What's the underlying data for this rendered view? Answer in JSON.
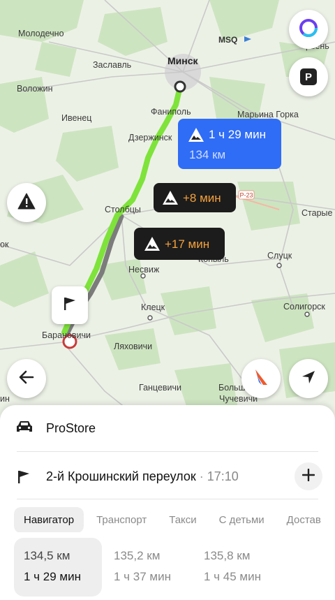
{
  "map": {
    "cities": [
      "Молодечно",
      "Заславль",
      "Минск",
      "Воложин",
      "Фаниполь",
      "Ивенец",
      "Марьина Горка",
      "Дзержинск",
      "Столбцы",
      "Старые",
      "Слуцк",
      "Несвиж",
      "Копыль",
      "Солигорск",
      "Клецк",
      "Барановичи",
      "Ляховичи",
      "Ганцевичи",
      "Больш",
      "Чучевичи",
      "ок",
      "ин",
      "рвень"
    ],
    "airport_label": "MSQ",
    "road_label": "Р-23"
  },
  "route_labels": {
    "main": {
      "time": "1 ч 29 мин",
      "distance": "134 км"
    },
    "alt1": {
      "diff": "+8 мин"
    },
    "alt2": {
      "diff": "+17 мин"
    }
  },
  "colors": {
    "accent": "#2f6df6",
    "route_active": "#7ee33a",
    "route_alt": "#7c7c7c",
    "dark_card": "#1c1c1c"
  },
  "icons": [
    "alice-icon",
    "parking-icon",
    "warning-icon",
    "flag-icon",
    "back-arrow-icon",
    "yandex-maps-icon",
    "location-arrow-icon",
    "car-icon",
    "plus-icon"
  ],
  "sheet": {
    "origin": "ProStore",
    "destination": "2-й Крошинский переулок",
    "separator": " · ",
    "arrival": "17:10",
    "tabs": [
      "Навигатор",
      "Транспорт",
      "Такси",
      "С детьми",
      "Достав"
    ],
    "options": [
      {
        "distance": "134,5 км",
        "time": "1 ч 29 мин"
      },
      {
        "distance": "135,2 км",
        "time": "1 ч 37 мин"
      },
      {
        "distance": "135,8 км",
        "time": "1 ч 45 мин"
      }
    ]
  }
}
